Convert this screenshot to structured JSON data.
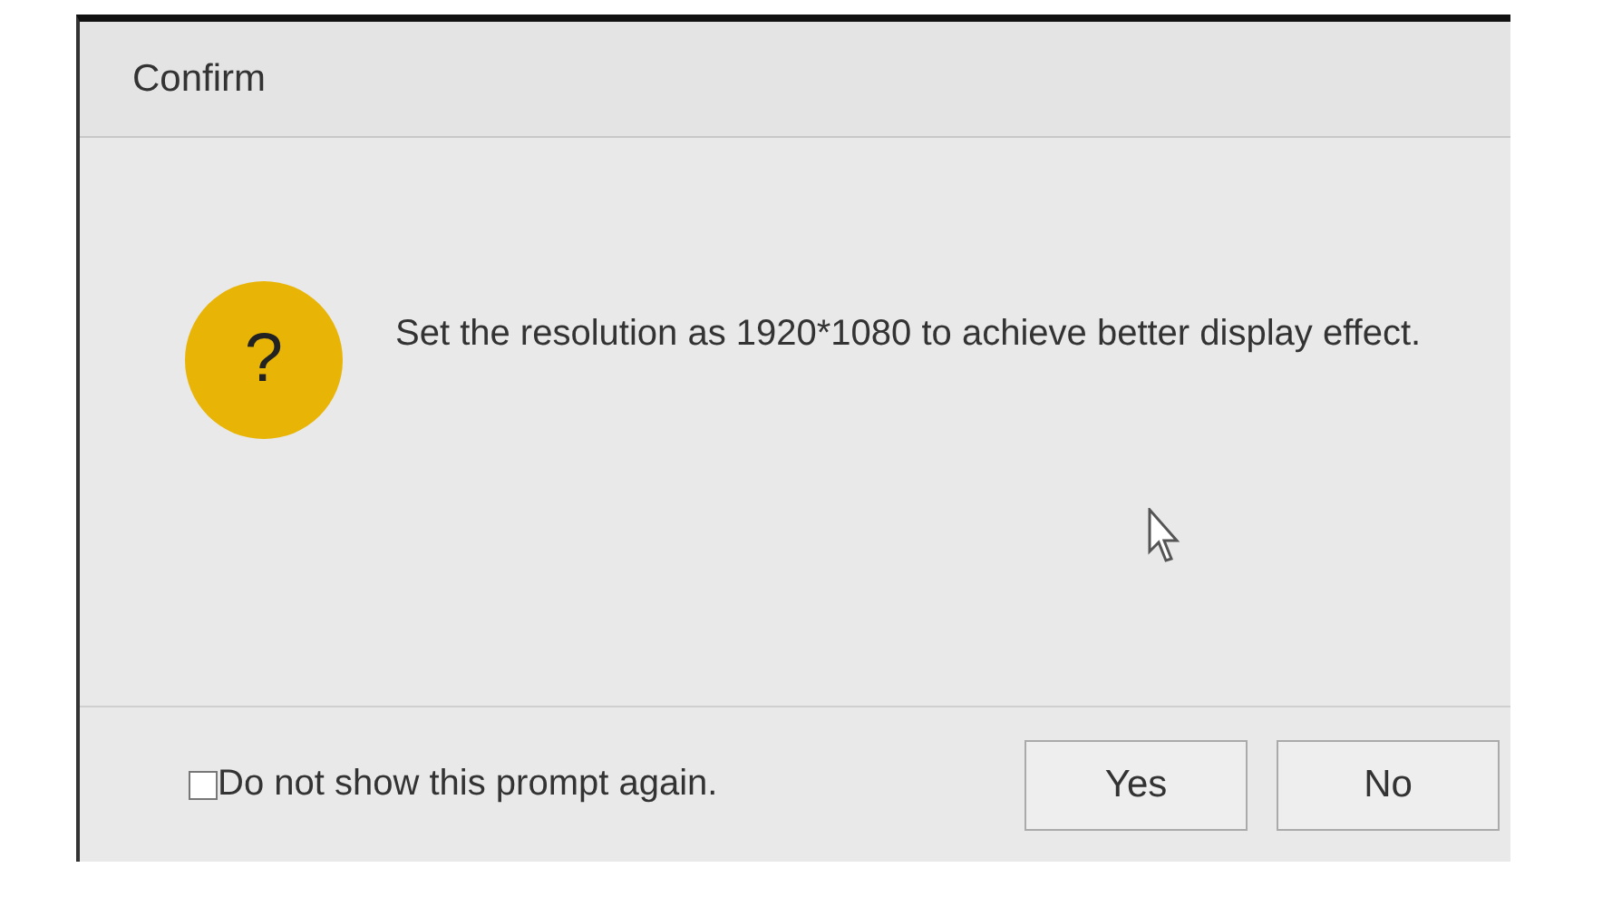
{
  "dialog": {
    "title": "Confirm",
    "icon": "?",
    "message": "Set the resolution as 1920*1080 to achieve better display effect.",
    "checkbox": {
      "label": "Do not show this prompt again.",
      "checked": false
    },
    "buttons": [
      "Yes",
      "No"
    ]
  }
}
